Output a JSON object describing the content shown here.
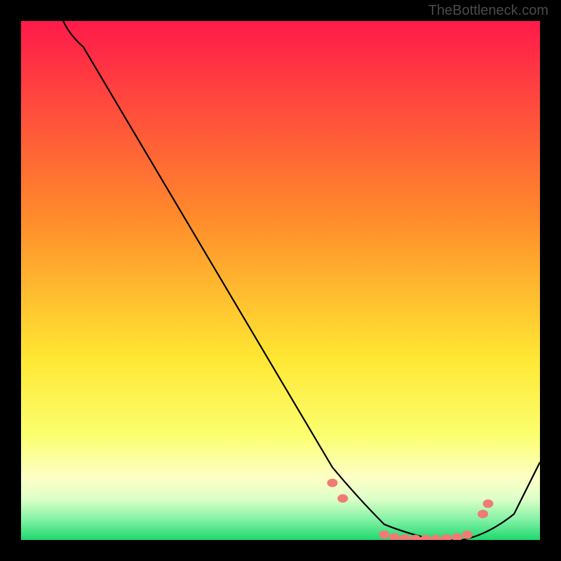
{
  "attribution": "TheBottleneck.com",
  "chart_data": {
    "type": "line",
    "title": "",
    "xlabel": "",
    "ylabel": "",
    "xlim": [
      0,
      100
    ],
    "ylim": [
      0,
      100
    ],
    "curve": {
      "description": "Bottleneck curve descending from top-left to a minimum trough then rising at right edge",
      "x": [
        8,
        12,
        60,
        65,
        70,
        75,
        80,
        85,
        90,
        95,
        100
      ],
      "y": [
        100,
        95,
        14,
        8,
        3,
        1,
        0,
        0,
        1,
        5,
        15
      ]
    },
    "markers": {
      "description": "Salmon dots along the trough region",
      "x": [
        60,
        62,
        70,
        72,
        74,
        76,
        78,
        80,
        82,
        84,
        86,
        89,
        90
      ],
      "y": [
        11,
        8,
        1,
        0.5,
        0.3,
        0.2,
        0.2,
        0.2,
        0.3,
        0.5,
        1,
        5,
        7
      ]
    },
    "background": {
      "type": "vertical-gradient",
      "description": "Red at top through orange, yellow, to green at bottom (performance heat gradient)",
      "stops": [
        {
          "pos": 0.0,
          "color": "#ff1a4a"
        },
        {
          "pos": 0.38,
          "color": "#ff8b2b"
        },
        {
          "pos": 0.65,
          "color": "#ffe733"
        },
        {
          "pos": 0.8,
          "color": "#fbff70"
        },
        {
          "pos": 0.88,
          "color": "#fdffc6"
        },
        {
          "pos": 0.92,
          "color": "#dfffc8"
        },
        {
          "pos": 0.96,
          "color": "#85f2a6"
        },
        {
          "pos": 1.0,
          "color": "#1fd86e"
        }
      ]
    }
  }
}
